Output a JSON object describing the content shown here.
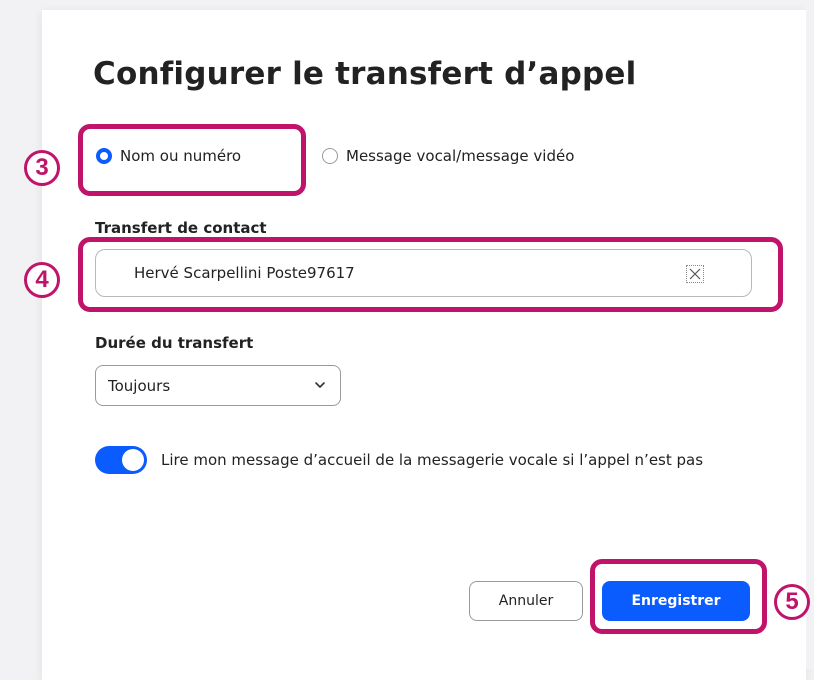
{
  "dialog": {
    "title": "Configurer le transfert d’appel",
    "radio_options": [
      {
        "label": "Nom ou numéro",
        "selected": true
      },
      {
        "label": "Message vocal/message vidéo",
        "selected": false
      }
    ],
    "contact_field": {
      "label": "Transfert de contact",
      "value": "Hervé Scarpellini Poste97617",
      "clear_icon": "clear-icon"
    },
    "duration_field": {
      "label": "Durée du transfert",
      "selected": "Toujours",
      "icon": "chevron-down-icon"
    },
    "toggle": {
      "on": true,
      "label": "Lire mon message d’accueil de la messagerie vocale si l’appel n’est pas"
    },
    "buttons": {
      "cancel": "Annuler",
      "save": "Enregistrer"
    }
  },
  "annotations": [
    {
      "number": "3"
    },
    {
      "number": "4"
    },
    {
      "number": "5"
    }
  ],
  "colors": {
    "accent": "#0b5cff",
    "annotation": "#c0136a",
    "background": "#f2f2f4"
  }
}
